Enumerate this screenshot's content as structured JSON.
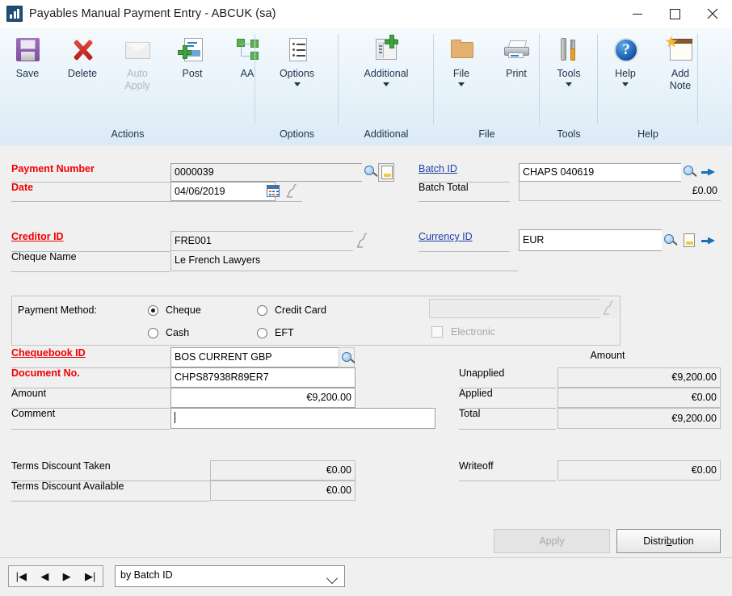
{
  "window": {
    "title": "Payables Manual Payment Entry  -  ABCUK (sa)",
    "app_icon": "chart-bars-icon",
    "minimize": "–",
    "maximize": "□",
    "close": "✕"
  },
  "ribbon": {
    "groups": [
      {
        "name": "Actions",
        "label": "Actions",
        "buttons": [
          {
            "label": "Save",
            "icon": "floppy-disk-icon",
            "disabled": false,
            "dropdown": false
          },
          {
            "label": "Delete",
            "icon": "red-x-icon",
            "disabled": false,
            "dropdown": false
          },
          {
            "label": "Auto\nApply",
            "icon": "envelope-icon",
            "disabled": true,
            "dropdown": false
          },
          {
            "label": "Post",
            "icon": "document-plus-icon",
            "disabled": false,
            "dropdown": false
          },
          {
            "label": "AA",
            "icon": "hierarchy-green-icon",
            "disabled": false,
            "dropdown": false
          }
        ]
      },
      {
        "name": "Options",
        "label": "Options",
        "buttons": [
          {
            "label": "Options",
            "icon": "list-document-icon",
            "disabled": false,
            "dropdown": true
          }
        ]
      },
      {
        "name": "Additional",
        "label": "Additional",
        "buttons": [
          {
            "label": "Additional",
            "icon": "window-plus-icon",
            "disabled": false,
            "dropdown": true
          }
        ]
      },
      {
        "name": "File",
        "label": "File",
        "buttons": [
          {
            "label": "File",
            "icon": "folder-icon",
            "disabled": false,
            "dropdown": true
          },
          {
            "label": "Print",
            "icon": "printer-icon",
            "disabled": false,
            "dropdown": false
          }
        ]
      },
      {
        "name": "Tools",
        "label": "Tools",
        "buttons": [
          {
            "label": "Tools",
            "icon": "wrench-screwdriver-icon",
            "disabled": false,
            "dropdown": true
          }
        ]
      },
      {
        "name": "Help",
        "label": "Help",
        "buttons": [
          {
            "label": "Help",
            "icon": "question-circle-icon",
            "disabled": false,
            "dropdown": true
          },
          {
            "label": "Add\nNote",
            "icon": "note-star-icon",
            "disabled": false,
            "dropdown": false
          }
        ]
      }
    ]
  },
  "form": {
    "payment_number": {
      "label": "Payment Number",
      "value": "0000039"
    },
    "date": {
      "label": "Date",
      "value": "04/06/2019"
    },
    "batch_id": {
      "label": "Batch ID",
      "value": "CHAPS 040619"
    },
    "batch_total": {
      "label": "Batch Total",
      "value": "£0.00"
    },
    "creditor_id": {
      "label": "Creditor ID",
      "value": "FRE001"
    },
    "cheque_name": {
      "label": "Cheque Name",
      "value": "Le French Lawyers"
    },
    "currency_id": {
      "label": "Currency ID",
      "value": "EUR"
    },
    "payment_method": {
      "label": "Payment Method:",
      "selected": "Cheque",
      "options": [
        "Cheque",
        "Credit Card",
        "Cash",
        "EFT"
      ],
      "card_name": {
        "value": ""
      },
      "electronic": {
        "label": "Electronic",
        "checked": false,
        "disabled": true
      }
    },
    "chequebook_id": {
      "label": "Chequebook ID",
      "value": "BOS CURRENT GBP"
    },
    "document_no": {
      "label": "Document No.",
      "value": "CHPS87938R89ER7"
    },
    "amount": {
      "label": "Amount",
      "value": "€9,200.00"
    },
    "comment": {
      "label": "Comment",
      "value": ""
    },
    "amount_column_header": "Amount",
    "unapplied": {
      "label": "Unapplied",
      "value": "€9,200.00"
    },
    "applied": {
      "label": "Applied",
      "value": "€0.00"
    },
    "total": {
      "label": "Total",
      "value": "€9,200.00"
    },
    "terms_discount_taken": {
      "label": "Terms Discount Taken",
      "value": "€0.00"
    },
    "terms_discount_available": {
      "label": "Terms Discount Available",
      "value": "€0.00"
    },
    "writeoff": {
      "label": "Writeoff",
      "value": "€0.00"
    },
    "apply_button": {
      "label": "Apply",
      "disabled": true
    },
    "distribution_button": {
      "label": "Distribution",
      "accel": "b",
      "disabled": false
    }
  },
  "navbar": {
    "first": "|◀",
    "prev": "◀",
    "next": "▶",
    "last": "▶|",
    "sort_by": "by Batch ID"
  },
  "colors": {
    "required_label": "#f20000",
    "link_label": "#1f3fa8",
    "ribbon_text": "#21374d",
    "window_bg": "#f0f0f0",
    "field_bg": "#ffffff",
    "readonly_bg": "#f0f0f0"
  }
}
